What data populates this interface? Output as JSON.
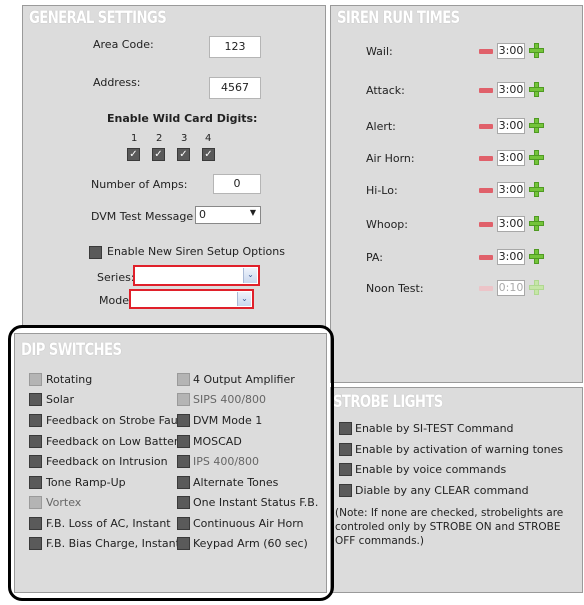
{
  "general": {
    "title": "GENERAL SETTINGS",
    "area_code_label": "Area Code:",
    "area_code_value": "123",
    "address_label": "Address:",
    "address_value": "4567",
    "wildcard_heading": "Enable Wild Card Digits:",
    "wildcard_digits": [
      "1",
      "2",
      "3",
      "4"
    ],
    "amps_label": "Number of Amps:",
    "amps_value": "0",
    "dvm_label": "DVM Test Message",
    "dvm_value": "0",
    "enable_new_label": "Enable New Siren Setup Options",
    "series_label": "Series:",
    "model_label": "Model"
  },
  "siren": {
    "title": "SIREN RUN TIMES",
    "rows": [
      {
        "label": "Wail:",
        "value": "3:00"
      },
      {
        "label": "Attack:",
        "value": "3:00"
      },
      {
        "label": "Alert:",
        "value": "3:00"
      },
      {
        "label": "Air Horn:",
        "value": "3:00"
      },
      {
        "label": "Hi-Lo:",
        "value": "3:00"
      },
      {
        "label": "Whoop:",
        "value": "3:00"
      },
      {
        "label": "PA:",
        "value": "3:00"
      },
      {
        "label": "Noon Test:",
        "value": "0:10"
      }
    ]
  },
  "dip": {
    "title": "DIP SWITCHES",
    "left": [
      "Rotating",
      "Solar",
      "Feedback on Strobe Fault",
      "Feedback on Low Battery",
      "Feedback on Intrusion",
      "Tone Ramp-Up",
      "Vortex",
      "F.B. Loss of AC, Instant",
      "F.B. Bias Charge, Instant"
    ],
    "right": [
      "4 Output Amplifier",
      "SIPS 400/800",
      "DVM Mode 1",
      "MOSCAD",
      "IPS 400/800",
      "Alternate Tones",
      "One Instant Status F.B.",
      "Continuous Air Horn",
      "Keypad Arm (60 sec)"
    ]
  },
  "strobe": {
    "title": "STROBE LIGHTS",
    "options": [
      "Enable by SI-TEST Command",
      "Enable by activation of warning tones",
      "Enable by voice commands",
      "Diable by any CLEAR command"
    ],
    "note": "(Note: If none are checked, strobelights are controled only by STROBE ON and STROBE OFF commands.)"
  },
  "icons": [
    "minus-icon",
    "plus-icon",
    "chevron-down-icon",
    "checkmark-icon"
  ],
  "colors": {
    "panel": "#dcdcdc",
    "highlight_red": "#e0202a",
    "plus_green": "#74c43a",
    "minus_red": "#e0606a"
  }
}
